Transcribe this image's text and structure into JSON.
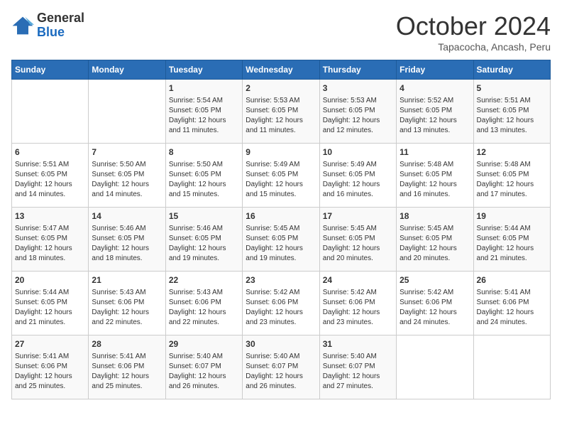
{
  "header": {
    "logo_general": "General",
    "logo_blue": "Blue",
    "month_title": "October 2024",
    "subtitle": "Tapacocha, Ancash, Peru"
  },
  "days_of_week": [
    "Sunday",
    "Monday",
    "Tuesday",
    "Wednesday",
    "Thursday",
    "Friday",
    "Saturday"
  ],
  "weeks": [
    [
      {
        "day": "",
        "detail": ""
      },
      {
        "day": "",
        "detail": ""
      },
      {
        "day": "1",
        "detail": "Sunrise: 5:54 AM\nSunset: 6:05 PM\nDaylight: 12 hours and 11 minutes."
      },
      {
        "day": "2",
        "detail": "Sunrise: 5:53 AM\nSunset: 6:05 PM\nDaylight: 12 hours and 11 minutes."
      },
      {
        "day": "3",
        "detail": "Sunrise: 5:53 AM\nSunset: 6:05 PM\nDaylight: 12 hours and 12 minutes."
      },
      {
        "day": "4",
        "detail": "Sunrise: 5:52 AM\nSunset: 6:05 PM\nDaylight: 12 hours and 13 minutes."
      },
      {
        "day": "5",
        "detail": "Sunrise: 5:51 AM\nSunset: 6:05 PM\nDaylight: 12 hours and 13 minutes."
      }
    ],
    [
      {
        "day": "6",
        "detail": "Sunrise: 5:51 AM\nSunset: 6:05 PM\nDaylight: 12 hours and 14 minutes."
      },
      {
        "day": "7",
        "detail": "Sunrise: 5:50 AM\nSunset: 6:05 PM\nDaylight: 12 hours and 14 minutes."
      },
      {
        "day": "8",
        "detail": "Sunrise: 5:50 AM\nSunset: 6:05 PM\nDaylight: 12 hours and 15 minutes."
      },
      {
        "day": "9",
        "detail": "Sunrise: 5:49 AM\nSunset: 6:05 PM\nDaylight: 12 hours and 15 minutes."
      },
      {
        "day": "10",
        "detail": "Sunrise: 5:49 AM\nSunset: 6:05 PM\nDaylight: 12 hours and 16 minutes."
      },
      {
        "day": "11",
        "detail": "Sunrise: 5:48 AM\nSunset: 6:05 PM\nDaylight: 12 hours and 16 minutes."
      },
      {
        "day": "12",
        "detail": "Sunrise: 5:48 AM\nSunset: 6:05 PM\nDaylight: 12 hours and 17 minutes."
      }
    ],
    [
      {
        "day": "13",
        "detail": "Sunrise: 5:47 AM\nSunset: 6:05 PM\nDaylight: 12 hours and 18 minutes."
      },
      {
        "day": "14",
        "detail": "Sunrise: 5:46 AM\nSunset: 6:05 PM\nDaylight: 12 hours and 18 minutes."
      },
      {
        "day": "15",
        "detail": "Sunrise: 5:46 AM\nSunset: 6:05 PM\nDaylight: 12 hours and 19 minutes."
      },
      {
        "day": "16",
        "detail": "Sunrise: 5:45 AM\nSunset: 6:05 PM\nDaylight: 12 hours and 19 minutes."
      },
      {
        "day": "17",
        "detail": "Sunrise: 5:45 AM\nSunset: 6:05 PM\nDaylight: 12 hours and 20 minutes."
      },
      {
        "day": "18",
        "detail": "Sunrise: 5:45 AM\nSunset: 6:05 PM\nDaylight: 12 hours and 20 minutes."
      },
      {
        "day": "19",
        "detail": "Sunrise: 5:44 AM\nSunset: 6:05 PM\nDaylight: 12 hours and 21 minutes."
      }
    ],
    [
      {
        "day": "20",
        "detail": "Sunrise: 5:44 AM\nSunset: 6:05 PM\nDaylight: 12 hours and 21 minutes."
      },
      {
        "day": "21",
        "detail": "Sunrise: 5:43 AM\nSunset: 6:06 PM\nDaylight: 12 hours and 22 minutes."
      },
      {
        "day": "22",
        "detail": "Sunrise: 5:43 AM\nSunset: 6:06 PM\nDaylight: 12 hours and 22 minutes."
      },
      {
        "day": "23",
        "detail": "Sunrise: 5:42 AM\nSunset: 6:06 PM\nDaylight: 12 hours and 23 minutes."
      },
      {
        "day": "24",
        "detail": "Sunrise: 5:42 AM\nSunset: 6:06 PM\nDaylight: 12 hours and 23 minutes."
      },
      {
        "day": "25",
        "detail": "Sunrise: 5:42 AM\nSunset: 6:06 PM\nDaylight: 12 hours and 24 minutes."
      },
      {
        "day": "26",
        "detail": "Sunrise: 5:41 AM\nSunset: 6:06 PM\nDaylight: 12 hours and 24 minutes."
      }
    ],
    [
      {
        "day": "27",
        "detail": "Sunrise: 5:41 AM\nSunset: 6:06 PM\nDaylight: 12 hours and 25 minutes."
      },
      {
        "day": "28",
        "detail": "Sunrise: 5:41 AM\nSunset: 6:06 PM\nDaylight: 12 hours and 25 minutes."
      },
      {
        "day": "29",
        "detail": "Sunrise: 5:40 AM\nSunset: 6:07 PM\nDaylight: 12 hours and 26 minutes."
      },
      {
        "day": "30",
        "detail": "Sunrise: 5:40 AM\nSunset: 6:07 PM\nDaylight: 12 hours and 26 minutes."
      },
      {
        "day": "31",
        "detail": "Sunrise: 5:40 AM\nSunset: 6:07 PM\nDaylight: 12 hours and 27 minutes."
      },
      {
        "day": "",
        "detail": ""
      },
      {
        "day": "",
        "detail": ""
      }
    ]
  ]
}
